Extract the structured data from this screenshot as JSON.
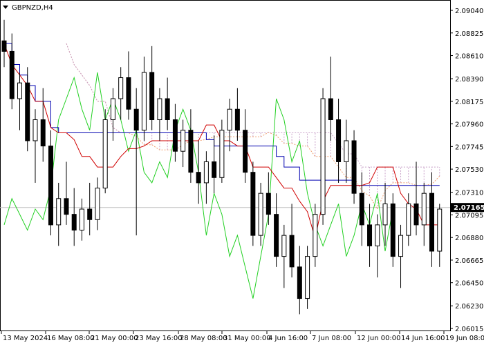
{
  "window": {
    "symbol_title": "GBPNZD,H4",
    "menu_icon": "triangle-down-icon"
  },
  "chart_data": {
    "type": "candlestick",
    "symbol": "GBPNZD",
    "timeframe": "H4",
    "y_ticks": [
      "2.09040",
      "2.08825",
      "2.08610",
      "2.08390",
      "2.08175",
      "2.07960",
      "2.07745",
      "2.07530",
      "2.07310",
      "2.07095",
      "2.06880",
      "2.06665",
      "2.06450",
      "2.06230",
      "2.06015"
    ],
    "ylim": [
      2.06015,
      2.0904
    ],
    "x_labels": [
      "13 May 2024",
      "16 May 08:00",
      "21 May 00:00",
      "23 May 16:00",
      "28 May 08:00",
      "31 May 00:00",
      "4 Jun 16:00",
      "7 Jun 08:00",
      "12 Jun 00:00",
      "14 Jun 16:00",
      "19 Jun 08:00"
    ],
    "current_price": "2.07165",
    "current_price_value": 2.07165,
    "colors": {
      "candle": "#000000",
      "tenkan_sen": "#d00000",
      "kijun_sen": "#0000b0",
      "chikou_span": "#22d022",
      "senkou_span_a": "#f0a070",
      "senkou_span_b": "#c8a0c8",
      "current_price_line": "#c0c0c0",
      "price_tag_bg": "#000000"
    },
    "candles": [
      [
        2.0875,
        2.0895,
        2.085,
        2.0865
      ],
      [
        2.0865,
        2.0882,
        2.081,
        2.082
      ],
      [
        2.082,
        2.0845,
        2.079,
        2.0835
      ],
      [
        2.0835,
        2.085,
        2.077,
        2.078
      ],
      [
        2.078,
        2.081,
        2.074,
        2.08
      ],
      [
        2.08,
        2.083,
        2.076,
        2.0775
      ],
      [
        2.0775,
        2.079,
        2.069,
        2.07
      ],
      [
        2.07,
        2.074,
        2.068,
        2.0725
      ],
      [
        2.0725,
        2.076,
        2.07,
        2.071
      ],
      [
        2.071,
        2.0735,
        2.068,
        2.0695
      ],
      [
        2.0695,
        2.0725,
        2.0685,
        2.0715
      ],
      [
        2.0715,
        2.074,
        2.069,
        2.0705
      ],
      [
        2.0705,
        2.0745,
        2.0695,
        2.0735
      ],
      [
        2.0735,
        2.081,
        2.073,
        2.08
      ],
      [
        2.08,
        2.083,
        2.078,
        2.082
      ],
      [
        2.082,
        2.085,
        2.08,
        2.084
      ],
      [
        2.084,
        2.0865,
        2.08,
        2.081
      ],
      [
        2.081,
        2.083,
        2.069,
        2.079
      ],
      [
        2.079,
        2.086,
        2.078,
        2.0845
      ],
      [
        2.0845,
        2.087,
        2.079,
        2.08
      ],
      [
        2.08,
        2.083,
        2.078,
        2.082
      ],
      [
        2.082,
        2.084,
        2.079,
        2.08
      ],
      [
        2.08,
        2.0815,
        2.076,
        2.077
      ],
      [
        2.077,
        2.08,
        2.0755,
        2.079
      ],
      [
        2.079,
        2.081,
        2.074,
        2.075
      ],
      [
        2.075,
        2.078,
        2.072,
        2.074
      ],
      [
        2.074,
        2.077,
        2.072,
        2.076
      ],
      [
        2.076,
        2.0785,
        2.073,
        2.0745
      ],
      [
        2.0745,
        2.08,
        2.074,
        2.079
      ],
      [
        2.079,
        2.082,
        2.077,
        2.081
      ],
      [
        2.081,
        2.083,
        2.078,
        2.079
      ],
      [
        2.079,
        2.081,
        2.074,
        2.075
      ],
      [
        2.075,
        2.076,
        2.068,
        2.069
      ],
      [
        2.069,
        2.074,
        2.068,
        2.073
      ],
      [
        2.073,
        2.075,
        2.07,
        2.071
      ],
      [
        2.071,
        2.073,
        2.066,
        2.067
      ],
      [
        2.067,
        2.07,
        2.064,
        2.069
      ],
      [
        2.069,
        2.072,
        2.065,
        2.066
      ],
      [
        2.066,
        2.068,
        2.0615,
        2.063
      ],
      [
        2.063,
        2.068,
        2.062,
        2.067
      ],
      [
        2.067,
        2.072,
        2.066,
        2.071
      ],
      [
        2.071,
        2.083,
        2.07,
        2.082
      ],
      [
        2.082,
        2.086,
        2.078,
        2.08
      ],
      [
        2.08,
        2.082,
        2.074,
        2.076
      ],
      [
        2.076,
        2.08,
        2.074,
        2.078
      ],
      [
        2.078,
        2.079,
        2.072,
        2.073
      ],
      [
        2.073,
        2.075,
        2.068,
        2.07
      ],
      [
        2.07,
        2.072,
        2.066,
        2.068
      ],
      [
        2.068,
        2.071,
        2.065,
        2.07
      ],
      [
        2.07,
        2.074,
        2.068,
        2.072
      ],
      [
        2.072,
        2.073,
        2.066,
        2.067
      ],
      [
        2.067,
        2.07,
        2.064,
        2.069
      ],
      [
        2.069,
        2.073,
        2.068,
        2.072
      ],
      [
        2.072,
        2.076,
        2.069,
        2.07
      ],
      [
        2.07,
        2.074,
        2.068,
        2.073
      ],
      [
        2.073,
        2.075,
        2.066,
        2.0675
      ],
      [
        2.0675,
        2.072,
        2.066,
        2.0715
      ]
    ]
  }
}
